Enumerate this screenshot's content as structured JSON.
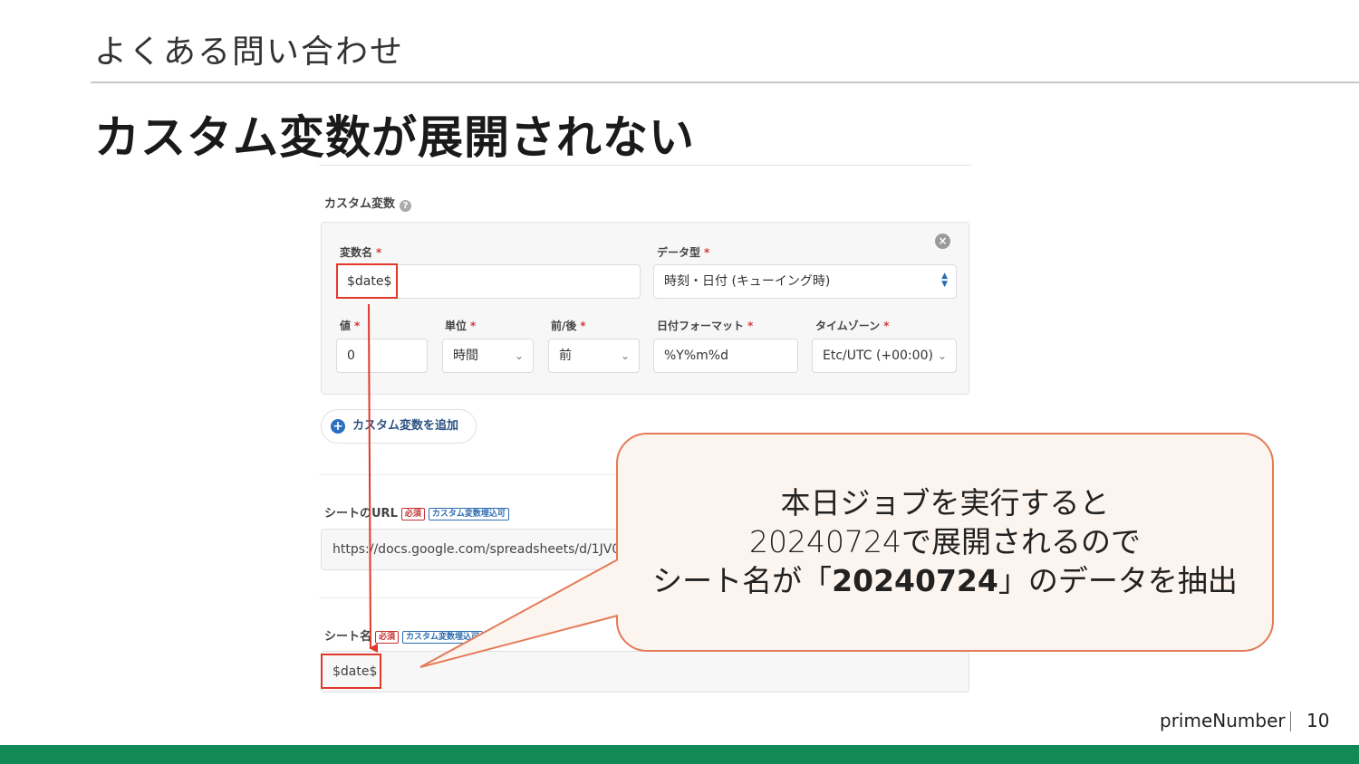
{
  "slide": {
    "section": "よくある問い合わせ",
    "title": "カスタム変数が展開されない",
    "brand": "primeNumber",
    "page_number": "10"
  },
  "screenshot": {
    "custom_variable_heading": "カスタム変数",
    "variable_name_label": "変数名",
    "variable_name_value": "$date$",
    "data_type_label": "データ型",
    "data_type_value": "時刻・日付 (キューイング時)",
    "value_label": "値",
    "value_value": "0",
    "unit_label": "単位",
    "unit_value": "時間",
    "before_after_label": "前/後",
    "before_after_value": "前",
    "date_format_label": "日付フォーマット",
    "date_format_value": "%Y%m%d",
    "timezone_label": "タイムゾーン",
    "timezone_value": "Etc/UTC (+00:00)",
    "required_mark": "*",
    "add_variable_button": "カスタム変数を追加",
    "sheet_url_label": "シートのURL",
    "sheet_url_value": "https://docs.google.com/spreadsheets/d/1JV07h",
    "sheet_name_label": "シート名",
    "sheet_name_value": "$date$",
    "badge_required": "必須",
    "badge_custom_var": "カスタム変数埋込可"
  },
  "callout": {
    "line1": "本日ジョブを実行すると",
    "line2": "20240724で展開されるので",
    "line3_pre": "シート名が「",
    "line3_bold": "20240724",
    "line3_post": "」のデータを抽出"
  },
  "colors": {
    "highlight_red": "#e0392b",
    "callout_border": "#e47a58",
    "callout_fill": "#fcf4ee",
    "footer_green": "#118a55",
    "link_blue": "#2c5282"
  },
  "icons": [
    "help-icon",
    "close-icon",
    "plus-icon",
    "chevron-down-icon",
    "up-down-icon"
  ]
}
